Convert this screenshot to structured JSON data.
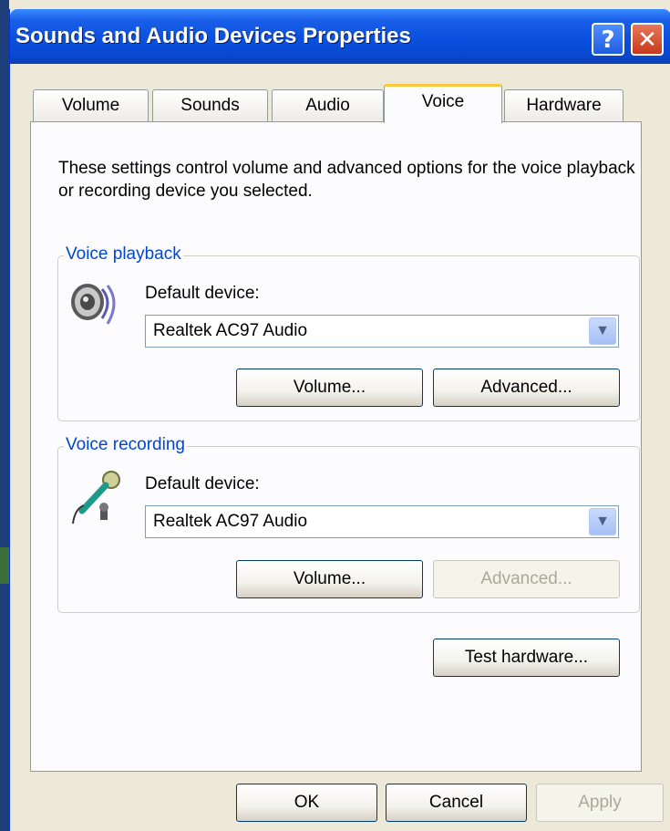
{
  "window": {
    "title": "Sounds and Audio Devices Properties",
    "help_glyph": "?",
    "close_glyph": "✕"
  },
  "tabs": [
    {
      "label": "Volume"
    },
    {
      "label": "Sounds"
    },
    {
      "label": "Audio"
    },
    {
      "label": "Voice",
      "active": true
    },
    {
      "label": "Hardware"
    }
  ],
  "description": "These settings control volume and advanced options for the voice playback or recording device you selected.",
  "playback": {
    "group_label": "Voice playback",
    "icon": "speaker-icon",
    "default_label": "Default device:",
    "device": "Realtek AC97 Audio",
    "volume_button": "Volume...",
    "advanced_button": "Advanced..."
  },
  "recording": {
    "group_label": "Voice recording",
    "icon": "microphone-icon",
    "default_label": "Default device:",
    "device": "Realtek AC97 Audio",
    "volume_button": "Volume...",
    "advanced_button": "Advanced..."
  },
  "test_hardware_button": "Test hardware...",
  "footer": {
    "ok": "OK",
    "cancel": "Cancel",
    "apply": "Apply"
  },
  "colors": {
    "title_bar": "#0A50DE",
    "group_label": "#0046D5",
    "active_tab_highlight": "#FFC83C",
    "dialog_bg": "#ECE9D8"
  }
}
